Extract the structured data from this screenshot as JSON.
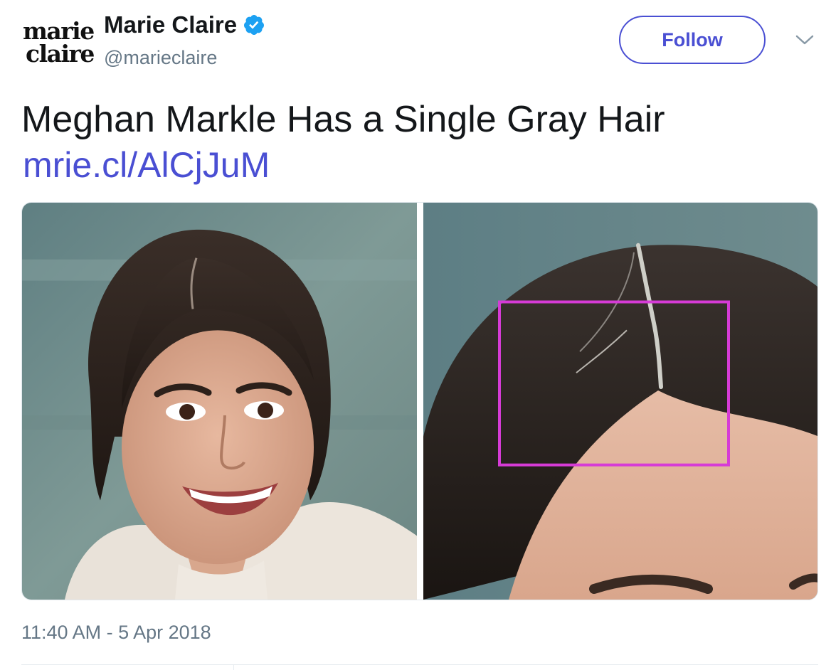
{
  "account": {
    "logo_line1": "marie",
    "logo_line2": "claire",
    "display_name": "Marie Claire",
    "handle": "@marieclaire",
    "verified": true,
    "verified_icon": "verified-badge-icon"
  },
  "actions": {
    "follow_label": "Follow",
    "more_icon": "chevron-down-icon"
  },
  "tweet": {
    "text": "Meghan Markle Has a Single Gray Hair",
    "link": "mrie.cl/AlCjJuM",
    "timestamp": "11:40 AM - 5 Apr 2018"
  },
  "colors": {
    "link": "#4a4fd3",
    "verified": "#1da1f2",
    "highlight_box": "#d63bd6",
    "secondary_text": "#657786"
  }
}
